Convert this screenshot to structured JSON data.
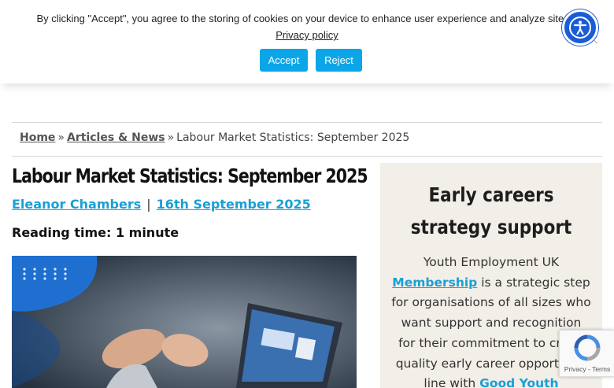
{
  "cookie_banner": {
    "message": "By clicking \"Accept\", you agree to the storing of cookies on your device to enhance user experience and analyze site us",
    "privacy_link": "Privacy policy",
    "accept_label": "Accept",
    "reject_label": "Reject",
    "close_label": "×",
    "accent": "#0ba6e8"
  },
  "accessibility": {
    "icon": "accessibility-icon",
    "color": "#1a5bd6"
  },
  "breadcrumb": {
    "home": "Home",
    "sep1": "»",
    "section": "Articles & News",
    "sep2": "»",
    "current": "Labour Market Statistics: September 2025"
  },
  "article": {
    "title": "Labour Market Statistics: September 2025",
    "author": "Eleanor Chambers",
    "separator": "|",
    "date": "16th September 2025",
    "reading_time": "Reading time: 1 minute",
    "link_color": "#1a9fd6"
  },
  "sidebar": {
    "title": "Early careers strategy support",
    "body_prefix": "Youth Employment UK",
    "membership_link": "Membership",
    "body_middle": "is a strategic step for organisations of all sizes who want support and recognition for their commitment to creati quality early career opportur in line with",
    "good_youth_link": "Good Youth",
    "background": "#f2eee8"
  },
  "recaptcha": {
    "label": "Privacy - Terms",
    "icon": "recaptcha-icon"
  }
}
